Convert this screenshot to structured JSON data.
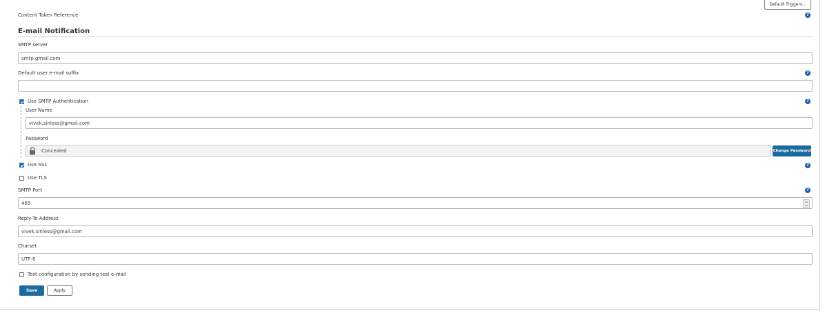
{
  "top": {
    "content_token_label": "Content Token Reference",
    "default_triggers_button": "Default Triggers..."
  },
  "section": {
    "title": "E-mail Notification"
  },
  "fields": {
    "smtp_server": {
      "label": "SMTP server",
      "value": "smtp.gmail.com"
    },
    "default_suffix": {
      "label": "Default user e-mail suffix",
      "value": ""
    },
    "use_smtp_auth": {
      "label": "Use SMTP Authentication",
      "checked": true
    },
    "user_name": {
      "label": "User Name",
      "value": "vivek.sinless@gmail.com"
    },
    "password": {
      "label": "Password",
      "value": "Concealed",
      "change_button": "Change Password"
    },
    "use_ssl": {
      "label": "Use SSL",
      "checked": true
    },
    "use_tls": {
      "label": "Use TLS",
      "checked": false
    },
    "smtp_port": {
      "label": "SMTP Port",
      "value": "465"
    },
    "reply_to": {
      "label": "Reply-To Address",
      "value": "vivek.sinless@gmail.com"
    },
    "charset": {
      "label": "Charset",
      "value": "UTF-8"
    },
    "test_config": {
      "label": "Test configuration by sending test e-mail",
      "checked": false
    }
  },
  "actions": {
    "save": "Save",
    "apply": "Apply"
  },
  "help_glyph": "?",
  "colors": {
    "primary_button": "#1c6ba0",
    "help_icon": "#1f5fa8",
    "checkbox_checked": "#2e6ba6"
  }
}
